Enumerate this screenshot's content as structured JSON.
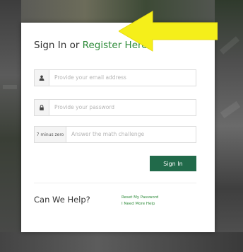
{
  "modal": {
    "title_prefix": "Sign In or ",
    "title_link": "Register Here"
  },
  "form": {
    "email_placeholder": "Provide your email address",
    "password_placeholder": "Provide your password",
    "math_question": "7 minus zero",
    "math_placeholder": "Answer the math challenge",
    "submit_label": "Sign In"
  },
  "help": {
    "title": "Can We Help?",
    "links": [
      "Reset My Password",
      "I Need More Help"
    ]
  },
  "colors": {
    "brand_green": "#2e8b3a",
    "button_green": "#216a4a",
    "arrow_yellow": "#f5ef1a"
  },
  "icons": {
    "email": "user-icon",
    "password": "lock-icon"
  }
}
